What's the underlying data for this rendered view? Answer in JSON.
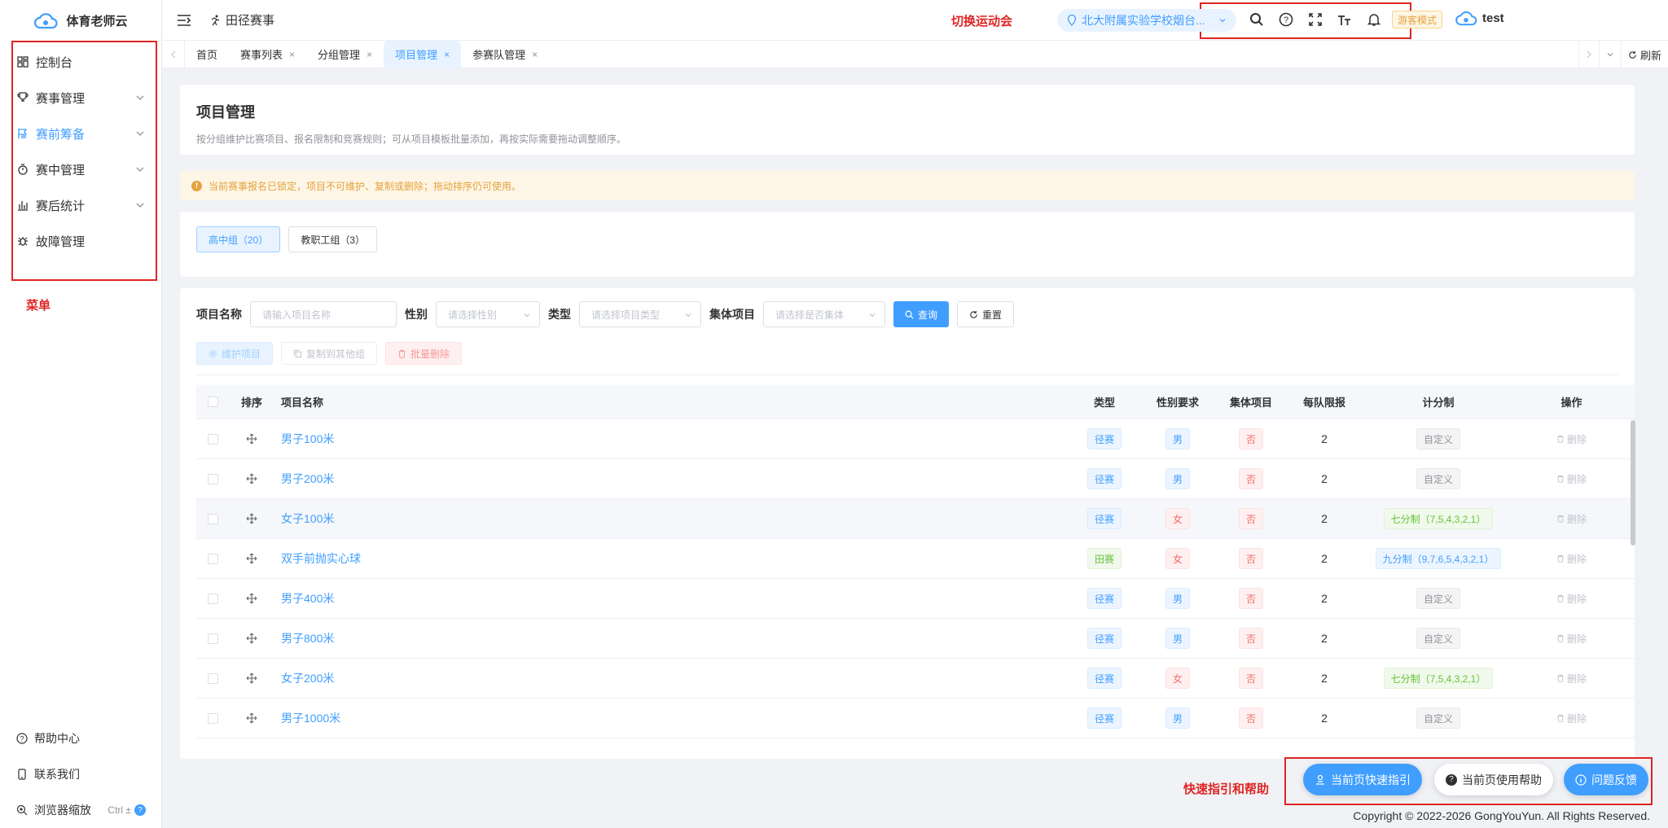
{
  "app": {
    "title": "体育老师云"
  },
  "sidebar": {
    "items": [
      {
        "label": "控制台",
        "icon": "dashboard-icon",
        "expandable": false,
        "active": false
      },
      {
        "label": "赛事管理",
        "icon": "trophy-icon",
        "expandable": true,
        "active": false
      },
      {
        "label": "赛前筹备",
        "icon": "flag-icon",
        "expandable": true,
        "active": true
      },
      {
        "label": "赛中管理",
        "icon": "stopwatch-icon",
        "expandable": true,
        "active": false
      },
      {
        "label": "赛后统计",
        "icon": "bar-chart-icon",
        "expandable": true,
        "active": false
      },
      {
        "label": "故障管理",
        "icon": "bug-icon",
        "expandable": false,
        "active": false
      }
    ],
    "annotation": "菜单",
    "bottom": {
      "help": "帮助中心",
      "contact": "联系我们",
      "zoom": "浏览器缩放",
      "zoom_shortcut": "Ctrl ±"
    }
  },
  "topbar": {
    "breadcrumb": "田径赛事",
    "switch_annotation": "切换运动会",
    "meet": "北大附属实验学校烟台...",
    "guest_mode": "游客模式",
    "user": "test"
  },
  "tabs": [
    {
      "label": "首页",
      "closable": false,
      "active": false
    },
    {
      "label": "赛事列表",
      "closable": true,
      "active": false
    },
    {
      "label": "分组管理",
      "closable": true,
      "active": false
    },
    {
      "label": "项目管理",
      "closable": true,
      "active": true
    },
    {
      "label": "参赛队管理",
      "closable": true,
      "active": false
    }
  ],
  "tabs_refresh": "刷新",
  "page": {
    "title": "项目管理",
    "description": "按分组维护比赛项目、报名限制和竞赛规则；可从项目模板批量添加，再按实际需要拖动调整顺序。",
    "alert": "当前赛事报名已锁定，项目不可维护、复制或删除；拖动排序仍可使用。"
  },
  "groups": [
    {
      "label": "高中组（20）",
      "active": true
    },
    {
      "label": "教职工组（3）",
      "active": false
    }
  ],
  "filters": {
    "name_label": "项目名称",
    "name_placeholder": "请输入项目名称",
    "gender_label": "性别",
    "gender_placeholder": "请选择性别",
    "type_label": "类型",
    "type_placeholder": "请选择项目类型",
    "team_label": "集体项目",
    "team_placeholder": "请选择是否集体",
    "search": "查询",
    "reset": "重置"
  },
  "actions": {
    "maintain": "维护项目",
    "copy": "复制到其他组",
    "batch_delete": "批量删除"
  },
  "table": {
    "headers": {
      "sort": "排序",
      "name": "项目名称",
      "type": "类型",
      "gender": "性别要求",
      "team": "集体项目",
      "limit": "每队限报",
      "score": "计分制",
      "op": "操作"
    },
    "delete_label": "删除",
    "rows": [
      {
        "name": "男子100米",
        "type": "径赛",
        "type_color": "blue",
        "gender": "男",
        "gender_color": "blue",
        "team": "否",
        "limit": "2",
        "score": "自定义",
        "score_color": "gray"
      },
      {
        "name": "男子200米",
        "type": "径赛",
        "type_color": "blue",
        "gender": "男",
        "gender_color": "blue",
        "team": "否",
        "limit": "2",
        "score": "自定义",
        "score_color": "gray"
      },
      {
        "name": "女子100米",
        "type": "径赛",
        "type_color": "blue",
        "gender": "女",
        "gender_color": "red",
        "team": "否",
        "limit": "2",
        "score": "七分制（7,5,4,3,2,1）",
        "score_color": "green"
      },
      {
        "name": "双手前抛实心球",
        "type": "田赛",
        "type_color": "green",
        "gender": "女",
        "gender_color": "red",
        "team": "否",
        "limit": "2",
        "score": "九分制（9,7,6,5,4,3,2,1）",
        "score_color": "blue"
      },
      {
        "name": "男子400米",
        "type": "径赛",
        "type_color": "blue",
        "gender": "男",
        "gender_color": "blue",
        "team": "否",
        "limit": "2",
        "score": "自定义",
        "score_color": "gray"
      },
      {
        "name": "男子800米",
        "type": "径赛",
        "type_color": "blue",
        "gender": "男",
        "gender_color": "blue",
        "team": "否",
        "limit": "2",
        "score": "自定义",
        "score_color": "gray"
      },
      {
        "name": "女子200米",
        "type": "径赛",
        "type_color": "blue",
        "gender": "女",
        "gender_color": "red",
        "team": "否",
        "limit": "2",
        "score": "七分制（7,5,4,3,2,1）",
        "score_color": "green"
      },
      {
        "name": "男子1000米",
        "type": "径赛",
        "type_color": "blue",
        "gender": "男",
        "gender_color": "blue",
        "team": "否",
        "limit": "2",
        "score": "自定义",
        "score_color": "gray"
      }
    ]
  },
  "help": {
    "annotation": "快速指引和帮助",
    "quick_guide": "当前页快速指引",
    "page_help": "当前页使用帮助",
    "feedback": "问题反馈"
  },
  "footer": {
    "copyright": "Copyright © 2022-2026 GongYouYun. All Rights Reserved."
  },
  "colors": {
    "primary": "#409eff",
    "annotation": "#e02424",
    "warning": "#e6a23c"
  }
}
